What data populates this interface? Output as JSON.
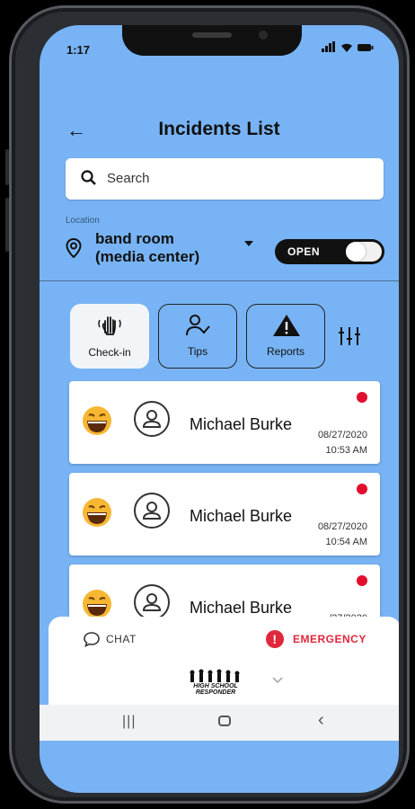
{
  "status": {
    "time": "1:17"
  },
  "header": {
    "title": "Incidents List"
  },
  "search": {
    "placeholder": "Search"
  },
  "location": {
    "label": "Location",
    "value_line1": "band room",
    "value_line2": "(media center)",
    "toggle_label": "OPEN",
    "toggle_on": true
  },
  "tabs": [
    {
      "label": "Check-in",
      "icon": "hand-wave-icon",
      "active": true
    },
    {
      "label": "Tips",
      "icon": "user-check-icon",
      "active": false
    },
    {
      "label": "Reports",
      "icon": "warning-icon",
      "active": false
    }
  ],
  "incidents": [
    {
      "name": "Michael Burke",
      "date": "08/27/2020",
      "time": "10:53 AM",
      "status_color": "#e30e2d"
    },
    {
      "name": "Michael Burke",
      "date": "08/27/2020",
      "time": "10:54 AM",
      "status_color": "#e30e2d"
    },
    {
      "name": "Michael Burke",
      "date": "/27/2020",
      "time": "",
      "status_color": "#e30e2d"
    }
  ],
  "bottom_bar": {
    "chat_label": "CHAT",
    "emergency_label": "EMERGENCY",
    "logo_text_line1": "HIGH SCHOOL",
    "logo_text_line2": "RESPONDER"
  },
  "colors": {
    "background": "#78b4f5",
    "emergency": "#e0273c",
    "status_dot": "#e30e2d"
  }
}
